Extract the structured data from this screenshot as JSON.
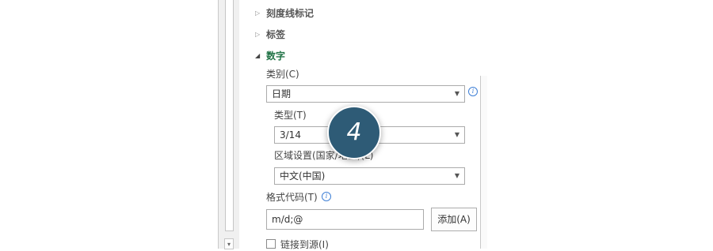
{
  "sections": {
    "tick_marks": "刻度线标记",
    "labels": "标签",
    "number": "数字"
  },
  "number": {
    "category_label": "类别(C)",
    "category_value": "日期",
    "type_label": "类型(T)",
    "type_value": "3/14",
    "locale_label": "区域设置(国家/地区)(L)",
    "locale_value": "中文(中国)",
    "format_code_label": "格式代码(T)",
    "format_code_value": "m/d;@",
    "add_button": "添加(A)",
    "link_to_source": "链接到源(I)"
  },
  "step_badge": "4",
  "colors": {
    "accent_green": "#217346",
    "badge": "#2e5b76",
    "info_blue": "#3e7fd6"
  }
}
